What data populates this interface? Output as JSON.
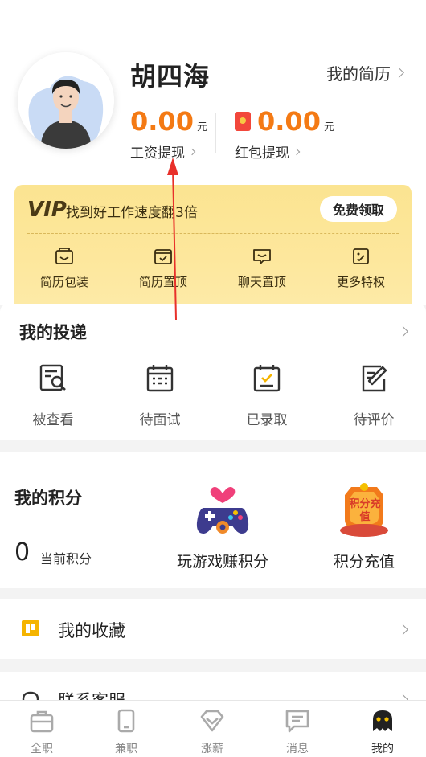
{
  "profile": {
    "name": "胡四海",
    "resume_link": "我的简历",
    "salary": {
      "amount": "0.00",
      "unit": "元",
      "label": "工资提现"
    },
    "redpacket": {
      "amount": "0.00",
      "unit": "元",
      "label": "红包提现"
    }
  },
  "vip": {
    "logo": "VIP",
    "text": "找到好工作速度翻3倍",
    "button": "免费领取",
    "items": [
      {
        "label": "简历包装",
        "icon": "resume-package-icon"
      },
      {
        "label": "简历置顶",
        "icon": "resume-top-icon"
      },
      {
        "label": "聊天置顶",
        "icon": "chat-top-icon"
      },
      {
        "label": "更多特权",
        "icon": "more-privileges-icon"
      }
    ]
  },
  "delivery": {
    "title": "我的投递",
    "items": [
      {
        "label": "被查看",
        "icon": "viewed-icon"
      },
      {
        "label": "待面试",
        "icon": "calendar-icon"
      },
      {
        "label": "已录取",
        "icon": "hired-icon"
      },
      {
        "label": "待评价",
        "icon": "edit-review-icon"
      }
    ]
  },
  "points": {
    "title": "我的积分",
    "value": "0",
    "value_label": "当前积分",
    "game_label": "玩游戏赚积分",
    "recharge_label": "积分充值",
    "recharge_badge": "积分充值"
  },
  "favorites": {
    "title": "我的收藏"
  },
  "service": {
    "title": "联系客服"
  },
  "tabs": [
    {
      "label": "全职",
      "icon": "fulltime-icon"
    },
    {
      "label": "兼职",
      "icon": "parttime-icon"
    },
    {
      "label": "涨薪",
      "icon": "raise-icon"
    },
    {
      "label": "消息",
      "icon": "message-icon"
    },
    {
      "label": "我的",
      "icon": "mine-icon"
    }
  ],
  "colors": {
    "accent": "#f47a14",
    "vip_bg": "#fbe491",
    "redpacket": "#f2473b",
    "annotation_arrow": "#e8302a"
  }
}
